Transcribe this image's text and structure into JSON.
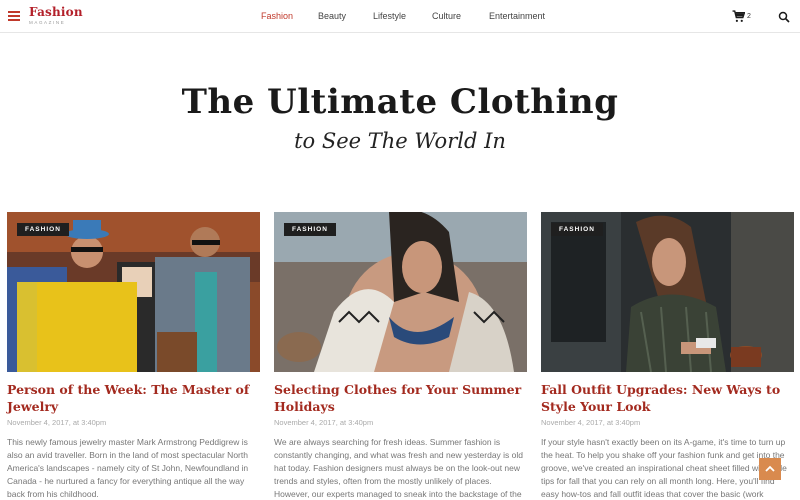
{
  "header": {
    "logo_main": "Fashion",
    "logo_sub": "MAGAZINE",
    "nav": [
      {
        "label": "Fashion"
      },
      {
        "label": "Beauty"
      },
      {
        "label": "Lifestyle"
      },
      {
        "label": "Culture"
      },
      {
        "label": "Entertainment"
      }
    ],
    "cart_count": "2"
  },
  "hero": {
    "title": "The Ultimate Clothing",
    "subtitle": "to See The World In"
  },
  "articles": [
    {
      "tag": "FASHION",
      "title": "Person of the Week: The Master of Jewelry",
      "date": "November 4, 2017, at 3:40pm",
      "excerpt": "This newly famous jewelry master Mark Armstrong Peddigrew is also an avid traveller. Born in the land of most spectacular North America's landscapes - namely city of St John, Newfoundland in Canada - he nurtured a fancy for everything antique all the way back from his childhood."
    },
    {
      "tag": "FASHION",
      "title": "Selecting Clothes for Your Summer Holidays",
      "date": "November 4, 2017, at 3:40pm",
      "excerpt": "We are always searching for fresh ideas. Summer fashion is constantly changing, and what was fresh and new yesterday is old hat today. Fashion designers must always be on the look-out new trends and styles, often from the mostly unlikely of places. However, our experts managed to sneak into the backstage of the"
    },
    {
      "tag": "FASHION",
      "title": "Fall Outfit Upgrades: New Ways to Style Your Look",
      "date": "November 4, 2017, at 3:40pm",
      "excerpt": "If your style hasn't exactly been on its A-game, it's time to turn up the heat. To help you shake off your fashion funk and get into the groove, we've created an inspirational cheat sheet filled with style tips for fall that you can rely on all month long. Here, you'll find easy how-tos and fall outfit ideas that cover the basic (work"
    }
  ]
}
